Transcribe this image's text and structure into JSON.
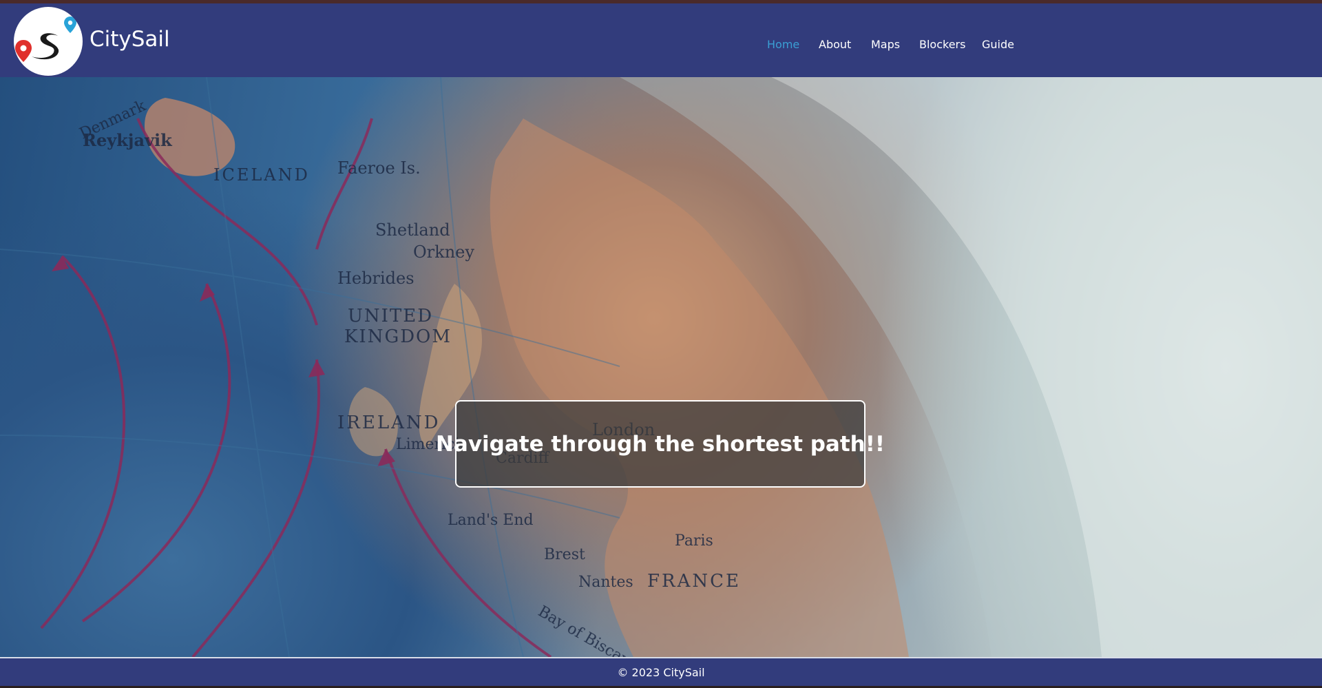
{
  "brand": {
    "name": "CitySail",
    "logo_icon": "route-pin-logo-icon"
  },
  "nav": {
    "items": [
      {
        "label": "Home",
        "active": true
      },
      {
        "label": "About",
        "active": false
      },
      {
        "label": "Maps",
        "active": false
      },
      {
        "label": "Blockers",
        "active": false
      },
      {
        "label": "Guide",
        "active": false
      }
    ]
  },
  "hero": {
    "headline": "Navigate through the shortest path!!",
    "background_image": "globe-map-europe-photo"
  },
  "footer": {
    "copyright": "© 2023 CitySail"
  },
  "colors": {
    "navbar": "#323c7c",
    "active_link": "#3a9fd4",
    "text": "#ffffff"
  }
}
